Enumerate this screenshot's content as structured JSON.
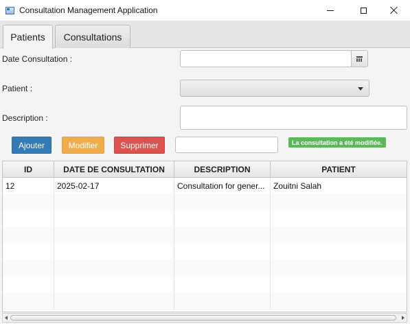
{
  "window": {
    "title": "Consultation Management Application",
    "icon": "app-window-icon"
  },
  "tabs": [
    {
      "label": "Patients",
      "selected": true
    },
    {
      "label": "Consultations",
      "selected": false
    }
  ],
  "form": {
    "date_label": "Date Consultation :",
    "date_value": "",
    "patient_label": "Patient :",
    "patient_value": "",
    "description_label": "Description :",
    "description_value": ""
  },
  "actions": {
    "add_label": "Ajouter",
    "edit_label": "Modifier",
    "delete_label": "Supprimer",
    "search_value": "",
    "status_message": "La consultation a été modifiée."
  },
  "colors": {
    "add": "#337ab7",
    "edit": "#f0ad4e",
    "delete": "#d9534f",
    "status": "#5cb85c"
  },
  "table": {
    "columns": [
      "ID",
      "DATE DE CONSULTATION",
      "DESCRIPTION",
      "PATIENT"
    ],
    "rows": [
      [
        "12",
        "2025-02-17",
        "Consultation for gener...",
        "Zouitni Salah"
      ]
    ]
  }
}
